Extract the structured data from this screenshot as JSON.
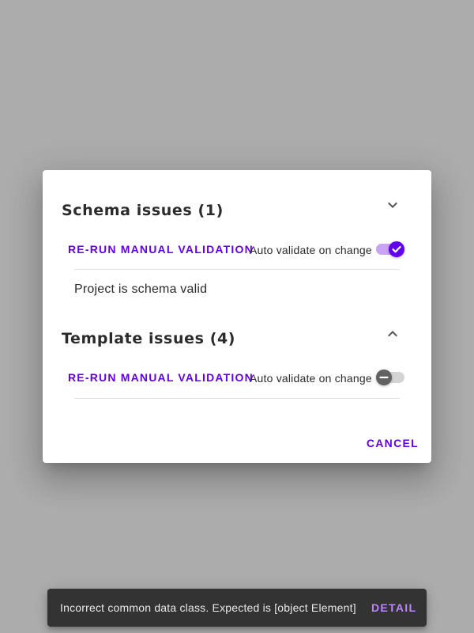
{
  "dialog": {
    "schema": {
      "title": "Schema issues (1)",
      "expanded": true,
      "rerun_label": "RE-RUN MANUAL VALIDATION",
      "auto_validate_label": "Auto validate on change",
      "auto_validate_on": true,
      "status_text": "Project is schema valid"
    },
    "template": {
      "title": "Template issues (4)",
      "expanded": false,
      "rerun_label": "RE-RUN MANUAL VALIDATION",
      "auto_validate_label": "Auto validate on change",
      "auto_validate_on": false
    },
    "cancel_label": "CANCEL"
  },
  "snackbar": {
    "message": "Incorrect common data class. Expected is [object Element]",
    "action_label": "DETAIL"
  },
  "colors": {
    "primary": "#6200ee",
    "primary_light": "#bb86fc",
    "backdrop": "#acacac",
    "snackbar_bg": "#333333"
  },
  "icons": {
    "schema_chevron": "chevron-down-icon",
    "template_chevron": "chevron-up-icon",
    "switch_on": "check-icon",
    "switch_off": "minus-icon"
  }
}
